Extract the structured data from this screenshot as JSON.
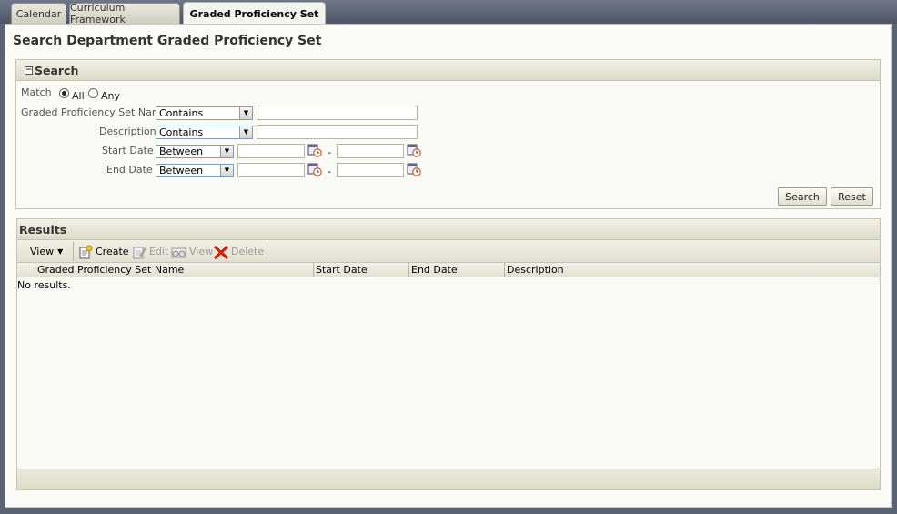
{
  "tabs": [
    {
      "label": "Calendar"
    },
    {
      "label": "Curriculum Framework"
    },
    {
      "label": "Graded Proficiency Set"
    }
  ],
  "page": {
    "title": "Search Department Graded Proficiency Set"
  },
  "search": {
    "header": "Search",
    "match_label": "Match",
    "match_all": "All",
    "match_any": "Any",
    "fields": {
      "name_label": "Graded Proficiency Set Name",
      "name_operator": "Contains",
      "name_value": "",
      "desc_label": "Description",
      "desc_operator": "Contains",
      "desc_value": "",
      "start_label": "Start Date",
      "start_operator": "Between",
      "end_label": "End Date",
      "end_operator": "Between",
      "range_sep": "-"
    },
    "search_button": "Search",
    "reset_button": "Reset"
  },
  "results": {
    "header": "Results",
    "toolbar": {
      "view_menu": "View",
      "create": "Create",
      "edit": "Edit",
      "view": "View",
      "delete": "Delete"
    },
    "columns": [
      "Graded Proficiency Set Name",
      "Start Date",
      "End Date",
      "Description"
    ],
    "empty_text": "No results."
  },
  "colors": {
    "header_bg": "#dedcc8",
    "page_bg": "#fbfbf8",
    "chrome_bg": "#5a6374",
    "label_text": "#555555",
    "delete_red": "#cc2200"
  }
}
